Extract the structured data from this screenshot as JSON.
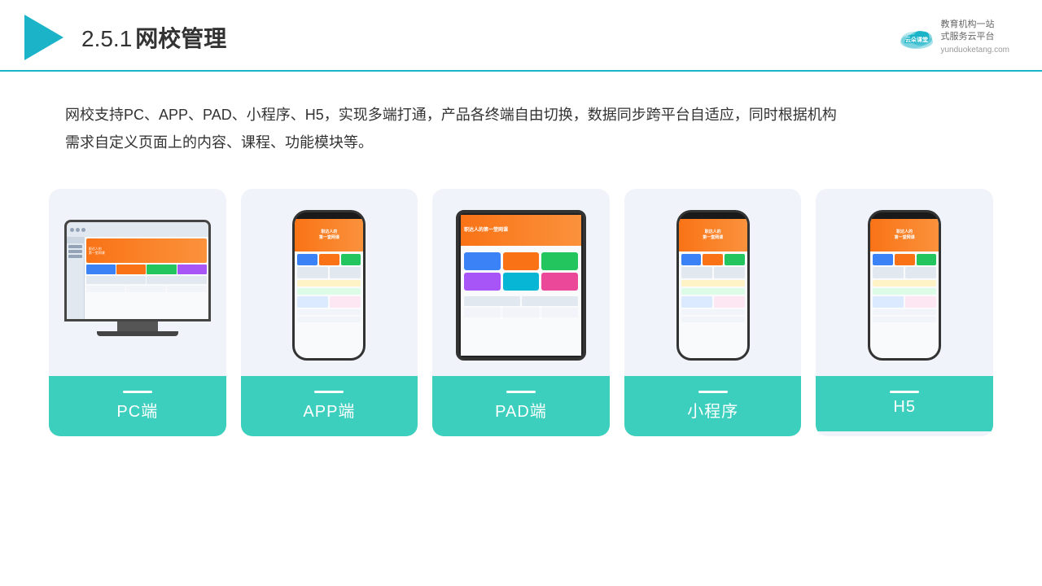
{
  "header": {
    "section_number": "2.5.1",
    "title": "网校管理",
    "brand_name": "云朵课堂",
    "brand_url": "yunduoketang.com",
    "brand_tagline": "教育机构一站",
    "brand_tagline2": "式服务云平台"
  },
  "description": "网校支持PC、APP、PAD、小程序、H5，实现多端打通，产品各终端自由切换，数据同步跨平台自适应，同时根据机构",
  "description2": "需求自定义页面上的内容、课程、功能模块等。",
  "cards": [
    {
      "id": "pc",
      "label": "PC端"
    },
    {
      "id": "app",
      "label": "APP端"
    },
    {
      "id": "pad",
      "label": "PAD端"
    },
    {
      "id": "miniapp",
      "label": "小程序"
    },
    {
      "id": "h5",
      "label": "H5"
    }
  ],
  "colors": {
    "teal": "#3dcfbe",
    "blue_accent": "#1ab3c8",
    "orange": "#f97316",
    "bg_card": "#eef2f8"
  }
}
